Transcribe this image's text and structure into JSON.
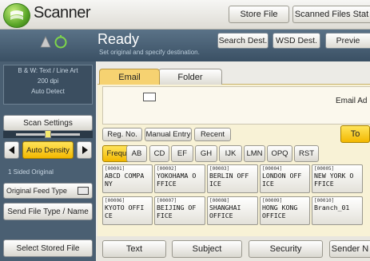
{
  "app": {
    "title": "Scanner"
  },
  "header": {
    "store_file": "Store File",
    "scanned_files_status": "Scanned Files Stat"
  },
  "status": {
    "state": "Ready",
    "message": "Set original and specify destination.",
    "search_dest": "Search Dest.",
    "wsd_dest": "WSD Dest.",
    "preview": "Previe"
  },
  "left_panel": {
    "scan_type": "B & W: Text / Line Art",
    "resolution": "200 dpi",
    "size": "Auto Detect",
    "scan_settings": "Scan Settings",
    "density_label": "Auto Density",
    "original_sides": "1 Sided Original",
    "original_feed_type": "Original Feed Type",
    "send_file_type": "Send File Type / Name",
    "select_stored_file": "Select Stored File"
  },
  "tabs": {
    "email": "Email",
    "folder": "Folder"
  },
  "destination": {
    "email_address_label": "Email Ad"
  },
  "actions": {
    "reg_no": "Reg. No.",
    "manual_entry": "Manual Entry",
    "recent": "Recent",
    "to": "To"
  },
  "index_tabs": [
    "Frequent",
    "AB",
    "CD",
    "EF",
    "GH",
    "IJK",
    "LMN",
    "OPQ",
    "RST"
  ],
  "destinations": [
    {
      "number": "[00001]",
      "name": "ABCD COMPA\nNY"
    },
    {
      "number": "[00002]",
      "name": "YOKOHAMA O\nFFICE"
    },
    {
      "number": "[00003]",
      "name": "BERLIN OFF\nICE"
    },
    {
      "number": "[00004]",
      "name": "LONDON OFF\nICE"
    },
    {
      "number": "[00005]",
      "name": "NEW YORK O\nFFICE"
    },
    {
      "number": "[00006]",
      "name": "KYOTO OFFI\nCE"
    },
    {
      "number": "[00007]",
      "name": "BEIJING OF\nFICE"
    },
    {
      "number": "[00008]",
      "name": "SHANGHAI\nOFFICE"
    },
    {
      "number": "[00009]",
      "name": "HONG KONG\nOFFICE"
    },
    {
      "number": "[00010]",
      "name": "Branch_01"
    }
  ],
  "bottom_tabs": {
    "text": "Text",
    "subject": "Subject",
    "security": "Security",
    "sender_name": "Sender N"
  }
}
